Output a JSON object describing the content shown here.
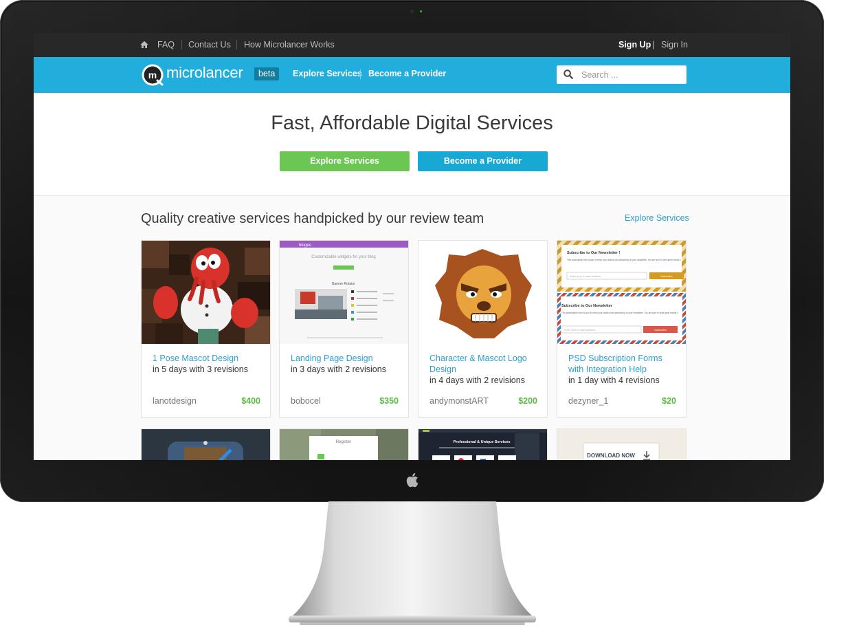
{
  "topbar": {
    "links": [
      "FAQ",
      "Contact Us",
      "How Microlancer Works"
    ],
    "sign_up": "Sign Up",
    "separator": "|",
    "sign_in": "Sign In"
  },
  "navbar": {
    "logo_text": "microlancer",
    "badge": "beta",
    "explore": "Explore Services",
    "become": "Become a Provider",
    "search_placeholder": "Search ..."
  },
  "hero": {
    "title": "Fast, Affordable Digital Services",
    "explore_button": "Explore Services",
    "provider_button": "Become a Provider"
  },
  "section": {
    "title": "Quality creative services handpicked by our review team",
    "link": "Explore Services"
  },
  "cards": [
    {
      "title": "1 Pose Mascot Design",
      "meta": "in 5 days with 3 revisions",
      "seller": "lanotdesign",
      "price": "$400"
    },
    {
      "title": "Landing Page Design",
      "meta": "in 3 days with 2 revisions",
      "seller": "bobocel",
      "price": "$350"
    },
    {
      "title": "Character & Mascot Logo Design",
      "meta": "in 4 days with 2 revisions",
      "seller": "andymonstART",
      "price": "$200"
    },
    {
      "title": "PSD Subscription Forms with Integration Help",
      "meta": "in 1 day with 4 revisions",
      "seller": "dezyner_1",
      "price": "$20"
    }
  ],
  "thumbs": {
    "landing_brand": "blogeo",
    "landing_headline": "Customizable widgets for your blog",
    "landing_slider": "Banner Rotator",
    "newsletter_title": "Subscribe to Our Newsletter !",
    "newsletter_title_2": "Subscribe to Our Newsletter",
    "newsletter_body": "This subscription form is sure to temp your visitors into subscribing to your newsletter. You are sure to yeild great results !!",
    "newsletter_placeholder": "enter your e-mail address",
    "newsletter_button": "Subscribe",
    "register": "Register",
    "professional": "Professional & Unique Services",
    "download": "DOWNLOAD NOW"
  },
  "colors": {
    "topbar": "#282828",
    "navbar": "#22aedc",
    "green": "#6cc653",
    "blue": "#17a9d3",
    "link": "#2b9fcf",
    "price": "#5dbb45"
  }
}
